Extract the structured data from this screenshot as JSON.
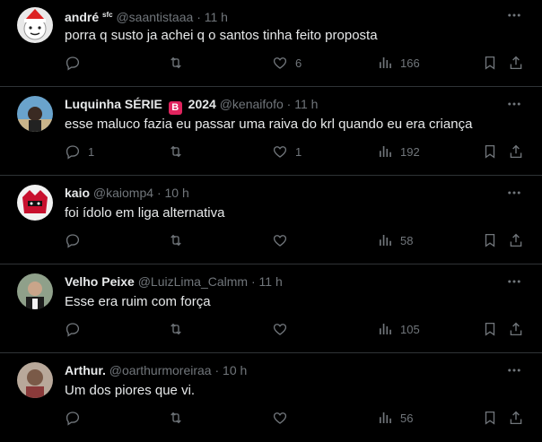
{
  "tweets": [
    {
      "name": "andré",
      "name_suffix": "sfc",
      "handle": "@saantistaaa",
      "time": "11 h",
      "text": "porra q susto ja achei q o santos tinha feito proposta",
      "replies": "",
      "retweets": "",
      "likes": "6",
      "views": "166",
      "avatar_color": "#cfcfcf"
    },
    {
      "name": "Luquinha SÉRIE",
      "badge": "B",
      "name_after_badge": "2024",
      "handle": "@kenaifofo",
      "time": "11 h",
      "text": "esse maluco fazia eu passar uma raiva do krl quando eu era criança",
      "replies": "1",
      "retweets": "",
      "likes": "1",
      "views": "192",
      "avatar_color": "#5b8fb3"
    },
    {
      "name": "kaio",
      "handle": "@kaiomp4",
      "time": "10 h",
      "text": "foi ídolo em liga alternativa",
      "replies": "",
      "retweets": "",
      "likes": "",
      "views": "58",
      "avatar_color": "#c8102e"
    },
    {
      "name": "Velho Peixe",
      "handle": "@LuizLima_Calmm",
      "time": "11 h",
      "text": "Esse era ruim com força",
      "replies": "",
      "retweets": "",
      "likes": "",
      "views": "105",
      "avatar_color": "#3a4a3a"
    },
    {
      "name": "Arthur.",
      "handle": "@oarthurmoreiraa",
      "time": "10 h",
      "text": "Um dos piores que vi.",
      "replies": "",
      "retweets": "",
      "likes": "",
      "views": "56",
      "avatar_color": "#8a6a5a"
    }
  ],
  "separator": "·",
  "colors": {
    "background": "#000000",
    "text": "#e7e9ea",
    "muted": "#71767b",
    "border": "#2f3336",
    "badge": "#e0245e"
  },
  "icons": [
    "more-icon",
    "reply-icon",
    "retweet-icon",
    "like-icon",
    "views-icon",
    "bookmark-icon",
    "share-icon"
  ]
}
